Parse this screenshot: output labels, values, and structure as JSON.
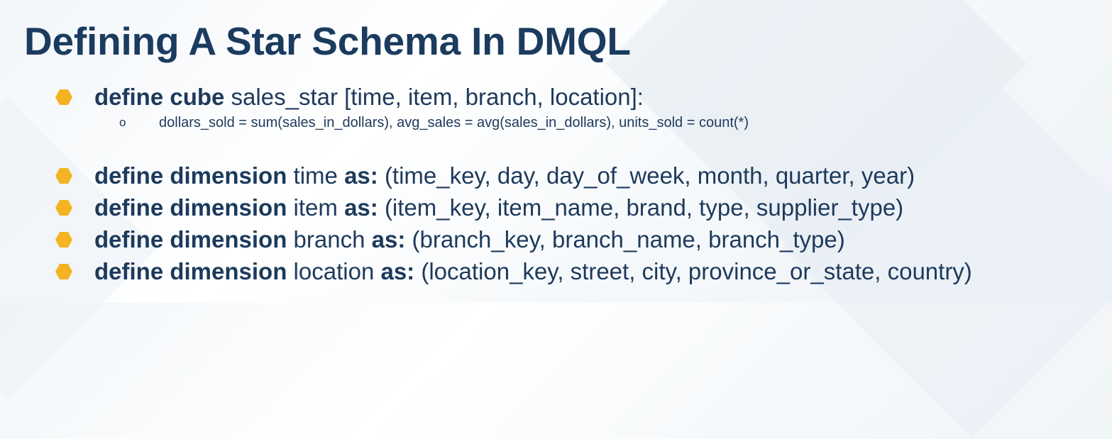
{
  "title": "Defining A Star Schema In DMQL",
  "colors": {
    "title": "#1b3b5f",
    "text": "#1d3a5c",
    "bullet": "#f3b323"
  },
  "bullet_icon": "hexagon-bullet-icon",
  "cube": {
    "keyword": "define cube",
    "text": "sales_star [time, item, branch, location]:",
    "sub_marker": "o",
    "measures": "dollars_sold = sum(sales_in_dollars), avg_sales = avg(sales_in_dollars), units_sold = count(*)"
  },
  "dimensions": [
    {
      "keyword": "define dimension",
      "name": "time",
      "as": "as:",
      "attributes": "(time_key, day, day_of_week, month, quarter, year)"
    },
    {
      "keyword": "define dimension",
      "name": "item",
      "as": "as:",
      "attributes": "(item_key, item_name, brand, type, supplier_type)"
    },
    {
      "keyword": "define dimension",
      "name": "branch",
      "as": "as:",
      "attributes": "(branch_key, branch_name, branch_type)"
    },
    {
      "keyword": "define dimension",
      "name": "location",
      "as": "as:",
      "attributes": "(location_key, street, city, province_or_state, country)"
    }
  ]
}
